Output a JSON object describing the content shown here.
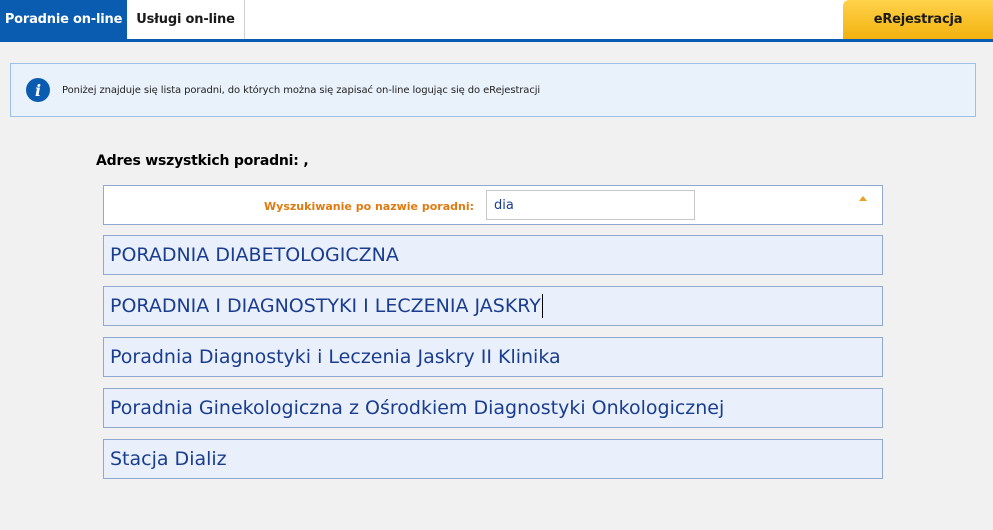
{
  "tabs": {
    "active_label": "Poradnie on-line",
    "second_label": "Usługi on-line",
    "eregistration_label": "eRejestracja"
  },
  "info": {
    "text": "Poniżej znajduje się lista poradni, do których można się zapisać on-line logując się do eRejestracji"
  },
  "address": {
    "label": "Adres wszystkich poradni: ,"
  },
  "search": {
    "label": "Wyszukiwanie po nazwie poradni:",
    "value": "dia"
  },
  "clinics": [
    "PORADNIA DIABETOLOGICZNA",
    "PORADNIA I DIAGNOSTYKI I LECZENIA JASKRY",
    "Poradnia Diagnostyki i Leczenia Jaskry II Klinika",
    "Poradnia Ginekologiczna z Ośrodkiem Diagnostyki Onkologicznej",
    "Stacja Dializ"
  ],
  "colors": {
    "primary_blue": "#0a5cb0",
    "accent_orange": "#e07a10",
    "ereg_yellow": "#f2b20f",
    "item_text": "#1a3d8f"
  },
  "icons": {
    "info": "info-icon",
    "collapse": "collapse-arrow-icon"
  }
}
